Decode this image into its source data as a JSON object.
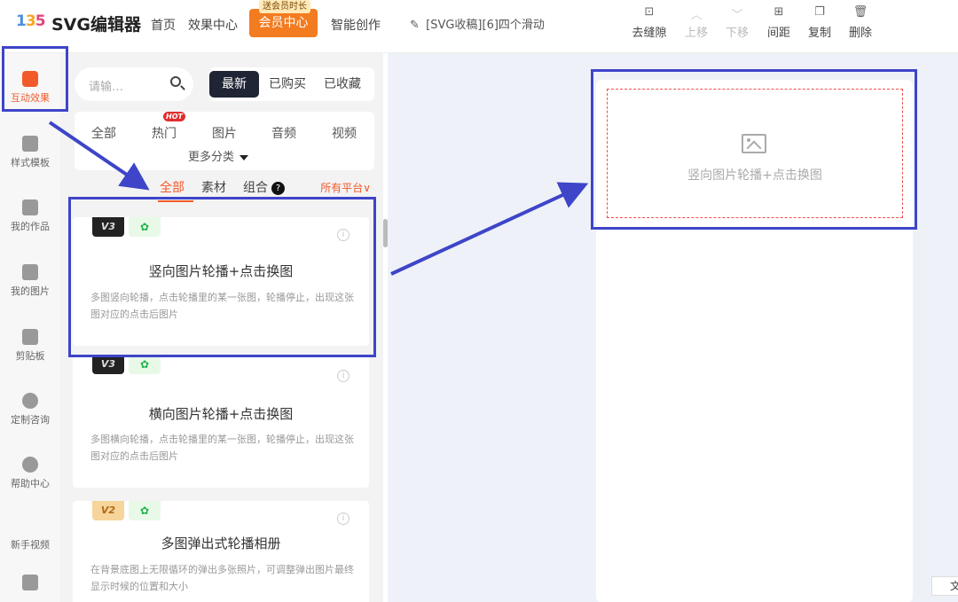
{
  "header": {
    "logo_mark": [
      "1",
      "3",
      "5"
    ],
    "logo_text": "SVG编辑器",
    "nav": [
      "首页",
      "效果中心"
    ],
    "vip_tag": "送会员时长",
    "vip_label": "会员中心",
    "ai_label": "智能创作",
    "doc_title": "[SVG收稿][6]四个滑动",
    "tools": [
      {
        "label": "去缝隙",
        "icon": "gap-icon",
        "enabled": true
      },
      {
        "label": "上移",
        "icon": "chevron-up-icon",
        "enabled": false
      },
      {
        "label": "下移",
        "icon": "chevron-down-icon",
        "enabled": false
      },
      {
        "label": "间距",
        "icon": "spacing-icon",
        "enabled": true
      },
      {
        "label": "复制",
        "icon": "copy-icon",
        "enabled": true
      },
      {
        "label": "删除",
        "icon": "trash-icon",
        "enabled": true
      }
    ]
  },
  "sidebar": {
    "items": [
      {
        "label": "互动效果",
        "icon": "cube-icon",
        "active": true
      },
      {
        "label": "样式模板",
        "icon": "template-icon"
      },
      {
        "label": "我的作品",
        "icon": "folder-icon"
      },
      {
        "label": "我的图片",
        "icon": "cloud-upload-icon"
      },
      {
        "label": "剪贴板",
        "icon": "clipboard-icon"
      },
      {
        "label": "定制咨询",
        "icon": "headset-icon"
      },
      {
        "label": "帮助中心",
        "icon": "help-icon"
      },
      {
        "label": "新手视频",
        "icon": ""
      },
      {
        "label": "",
        "icon": "document-icon"
      }
    ]
  },
  "library": {
    "search_placeholder": "请输…",
    "sort_tabs": [
      "最新",
      "已购买",
      "已收藏"
    ],
    "sort_active": "最新",
    "categories": [
      "全部",
      "热门",
      "图片",
      "音频",
      "视频"
    ],
    "hot_badge": "HOT",
    "more_categories": "更多分类",
    "filters": [
      "全部",
      "素材",
      "组合"
    ],
    "filter_help": "?",
    "platform": "所有平台∨",
    "cards": [
      {
        "version": "V3",
        "wechat": "✿",
        "title": "竖向图片轮播+点击换图",
        "desc": "多图竖向轮播，点击轮播里的某一张图，轮播停止，出现这张图对应的点击后图片"
      },
      {
        "version": "V3",
        "wechat": "✿",
        "title": "横向图片轮播+点击换图",
        "desc": "多图横向轮播，点击轮播里的某一张图，轮播停止，出现这张图对应的点击后图片"
      },
      {
        "version": "V2",
        "wechat": "✿",
        "title": "多图弹出式轮播相册",
        "desc": "在背景底图上无限循环的弹出多张照片，可调整弹出图片最终显示时候的位置和大小"
      }
    ]
  },
  "canvas": {
    "placeholder_text": "竖向图片轮播+点击换图",
    "corner_btn": "文"
  },
  "colors": {
    "accent": "#f35a2a",
    "highlight": "#3e45c8",
    "vip": "#f37b20",
    "dark_tab": "#1f2534"
  }
}
